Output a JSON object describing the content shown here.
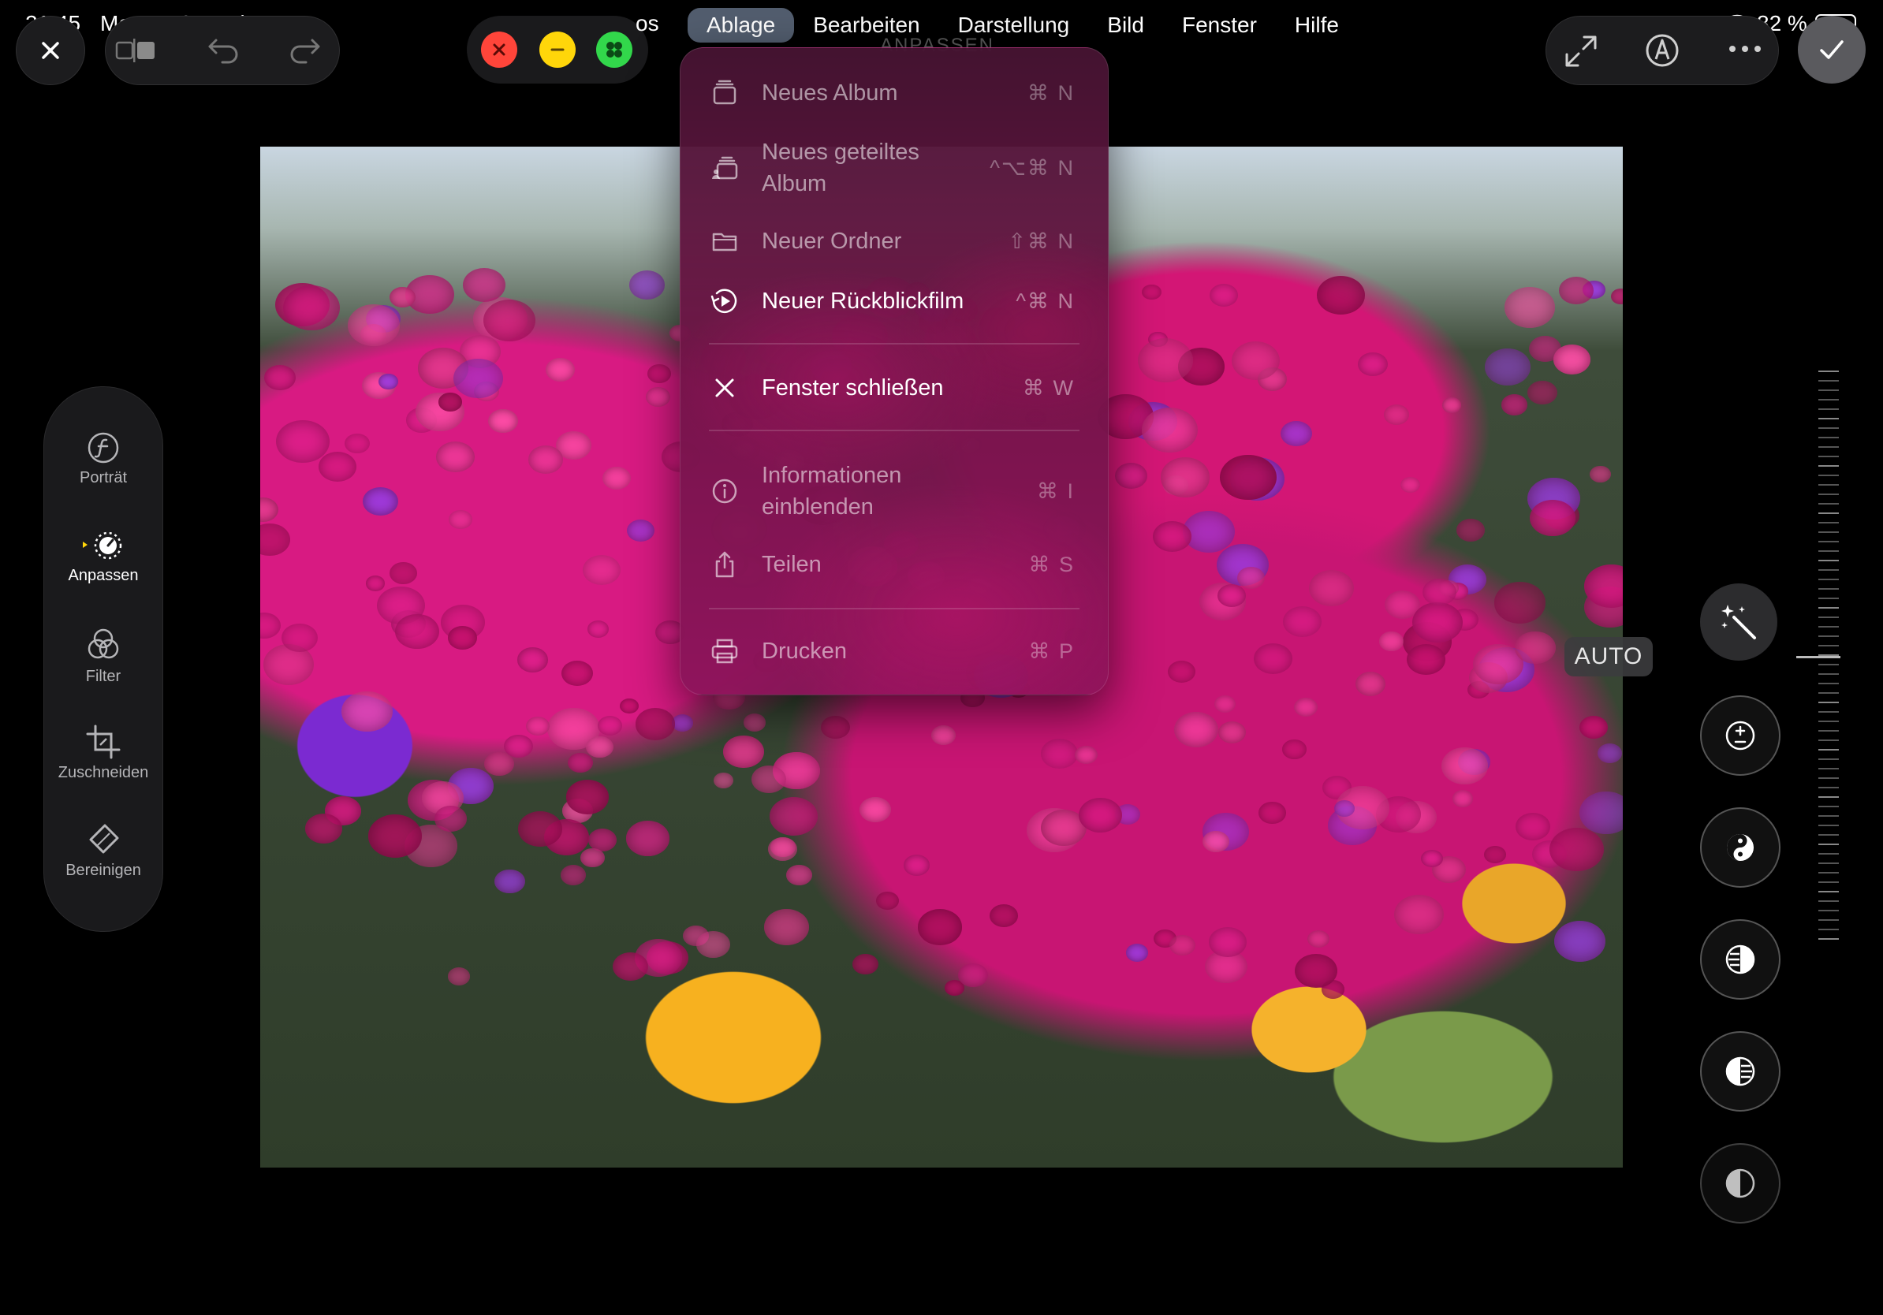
{
  "status_bar": {
    "time": "21:45",
    "date": "Montag 9. Juni",
    "battery": "82 %"
  },
  "menubar": {
    "partial_prev": "os",
    "items": [
      "Ablage",
      "Bearbeiten",
      "Darstellung",
      "Bild",
      "Fenster",
      "Hilfe"
    ],
    "active": "Ablage"
  },
  "window_title_ghost": "ANPASSEN",
  "file_menu": {
    "items": [
      {
        "label": "Neues Album",
        "shortcut": "⌘ N",
        "icon": "album-icon",
        "enabled": false
      },
      {
        "label": "Neues geteiltes Album",
        "shortcut": "^⌥⌘ N",
        "icon": "shared-album-icon",
        "enabled": false
      },
      {
        "label": "Neuer Ordner",
        "shortcut": "⇧⌘ N",
        "icon": "folder-icon",
        "enabled": false
      },
      {
        "label": "Neuer Rückblickfilm",
        "shortcut": "^⌘ N",
        "icon": "memory-movie-icon",
        "enabled": true
      },
      {
        "label": "Fenster schließen",
        "shortcut": "⌘ W",
        "icon": "close-icon",
        "enabled": true
      },
      {
        "label": "Informationen einblenden",
        "shortcut": "⌘ I",
        "icon": "info-icon",
        "enabled": false
      },
      {
        "label": "Teilen",
        "shortcut": "⌘ S",
        "icon": "share-icon",
        "enabled": false
      },
      {
        "label": "Drucken",
        "shortcut": "⌘ P",
        "icon": "printer-icon",
        "enabled": false
      }
    ]
  },
  "tools": [
    {
      "label": "Porträt",
      "icon": "aperture-f-icon",
      "active": false
    },
    {
      "label": "Anpassen",
      "icon": "adjust-dial-icon",
      "active": true
    },
    {
      "label": "Filter",
      "icon": "filter-circles-icon",
      "active": false
    },
    {
      "label": "Zuschneiden",
      "icon": "crop-icon",
      "active": false
    },
    {
      "label": "Bereinigen",
      "icon": "eraser-icon",
      "active": false
    }
  ],
  "adjustments": {
    "auto_label": "AUTO",
    "buttons": [
      "magic-wand-icon",
      "exposure-icon",
      "brilliance-icon",
      "highlights-icon",
      "shadows-icon",
      "contrast-icon"
    ]
  },
  "colors": {
    "accent_red": "#ff453a",
    "accent_yellow": "#ffd60a",
    "accent_green": "#32d74b",
    "menu_highlight": "#8ea3c2"
  }
}
